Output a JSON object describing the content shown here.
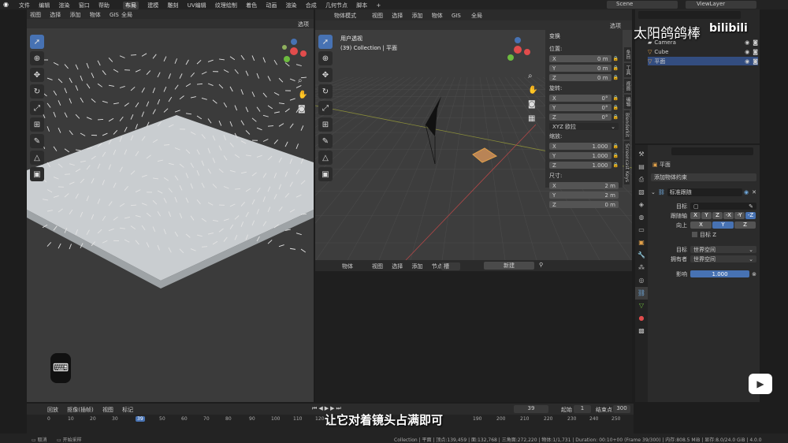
{
  "topbar": {
    "menus": [
      "文件",
      "编辑",
      "渲染",
      "窗口",
      "帮助"
    ],
    "workspaces": [
      "布局",
      "建模",
      "雕刻",
      "UV编辑",
      "纹理绘制",
      "着色",
      "动画",
      "渲染",
      "合成",
      "几何节点",
      "脚本"
    ],
    "active_workspace": "布局",
    "scene": "Scene",
    "view_layer": "ViewLayer"
  },
  "left_viewport": {
    "menus": [
      "视图",
      "选择",
      "添加",
      "物体",
      "GIS"
    ],
    "transform_orient": "全局",
    "options_label": "选项"
  },
  "right_viewport": {
    "mode": "物体模式",
    "menus": [
      "视图",
      "选择",
      "添加",
      "物体",
      "GIS"
    ],
    "transform_orient": "全局",
    "options_label": "选项",
    "view_name": "用户透视",
    "collection_info": "(39) Collection | 平面"
  },
  "npanel": {
    "section": "变换",
    "location_label": "位置:",
    "location": [
      {
        "axis": "X",
        "value": "0 m"
      },
      {
        "axis": "Y",
        "value": "0 m"
      },
      {
        "axis": "Z",
        "value": "0 m"
      }
    ],
    "rotation_label": "旋转:",
    "rotation": [
      {
        "axis": "X",
        "value": "0°"
      },
      {
        "axis": "Y",
        "value": "0°"
      },
      {
        "axis": "Z",
        "value": "0°"
      }
    ],
    "rotation_mode": "XYZ 欧拉",
    "scale_label": "缩放:",
    "scale": [
      {
        "axis": "X",
        "value": "1.000"
      },
      {
        "axis": "Y",
        "value": "1.000"
      },
      {
        "axis": "Z",
        "value": "1.000"
      }
    ],
    "dims_label": "尺寸:",
    "dims": [
      {
        "axis": "X",
        "value": "2 m"
      },
      {
        "axis": "Y",
        "value": "2 m"
      },
      {
        "axis": "Z",
        "value": "0 m"
      }
    ],
    "tabs": [
      "条目",
      "工具",
      "视图",
      "编辑",
      "Blenderkit",
      "Screencast Keys"
    ]
  },
  "node_editor": {
    "type": "物体",
    "menus": [
      "视图",
      "选择",
      "添加",
      "节点"
    ],
    "slot": "槽",
    "new_label": "新建"
  },
  "outliner": {
    "items": [
      {
        "name": "Camera"
      },
      {
        "name": "Cube"
      },
      {
        "name": "平面"
      }
    ]
  },
  "properties": {
    "object_name": "平面",
    "add_constraint": "添加物体约束",
    "constraint_name": "标准跟随",
    "target_label": "目标",
    "track_axis_label": "跟随轴",
    "track_axes": [
      "X",
      "Y",
      "Z",
      "-X",
      "-Y",
      "-Z"
    ],
    "active_track_axis": "-Z",
    "up_label": "向上",
    "up_axes": [
      "X",
      "Y",
      "Z"
    ],
    "active_up_axis": "Y",
    "target_z_label": "目标 Z",
    "target_space_label": "目标",
    "target_space": "世界空间",
    "owner_space_label": "拥有者",
    "owner_space": "世界空间",
    "influence_label": "影响",
    "influence": "1.000"
  },
  "timeline": {
    "menus": [
      "回放",
      "抠像(插帧)",
      "视图",
      "标记"
    ],
    "current_frame": "39",
    "start_label": "起始",
    "start": "1",
    "end_label": "结束点",
    "end": "300",
    "ticks": [
      "0",
      "10",
      "20",
      "30",
      "39",
      "50",
      "60",
      "70",
      "80",
      "90",
      "100",
      "110",
      "120",
      "190",
      "200",
      "210",
      "220",
      "230",
      "240",
      "250"
    ]
  },
  "statusbar": {
    "select": "取消",
    "pan": "开始采样",
    "stats": "Collection | 平面 | 顶点:139,459 | 面:132,768 | 三角面:272,220 | 物体:1/1,731 | Duration: 00:10+00 (Frame 39/300) | 内存:808.5 MiB | 显存:8.0/24.0 GiB | 4.0.0"
  },
  "overlay": {
    "subtitle": "让它对着镜头占满即可",
    "watermark": "太阳鸽鸽棒"
  },
  "colors": {
    "accent": "#4772b3",
    "active_object": "#e0a04a"
  }
}
